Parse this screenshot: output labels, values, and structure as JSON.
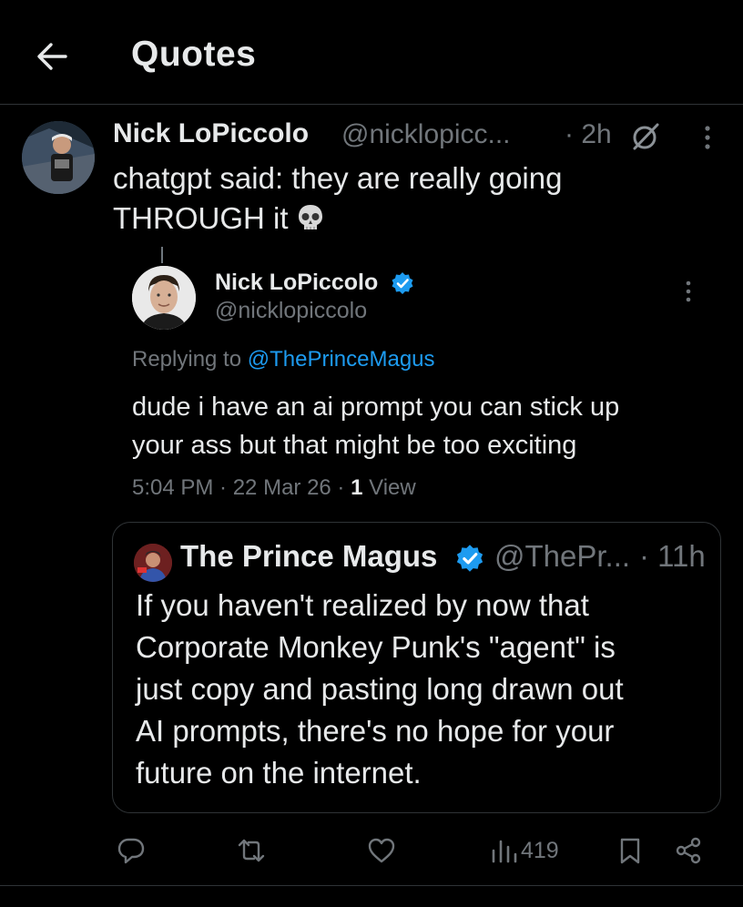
{
  "header": {
    "title": "Quotes"
  },
  "tweet": {
    "name": "Nick LoPiccolo",
    "handle": "@nicklopicc...",
    "time": "· 2h",
    "text_line1": "chatgpt said: they are really going",
    "text_line2": "THROUGH it"
  },
  "quoted_reply": {
    "name": "Nick LoPiccolo",
    "handle": "@nicklopiccolo",
    "replying_prefix": "Replying to ",
    "replying_to": "@ThePrinceMagus",
    "text_line1": "dude i have an ai prompt you can stick up",
    "text_line2": "your ass but that might be too exciting",
    "meta_time": "5:04 PM · 22 Mar 26 · ",
    "meta_views": "1",
    "meta_views_label": " View"
  },
  "embedded_quote": {
    "name": "The Prince Magus",
    "handle": "@ThePr...",
    "time": "· 11h",
    "lines": [
      "If you haven't realized by now that",
      "Corporate Monkey Punk's \"agent\" is",
      "just copy and pasting long drawn out",
      "AI prompts, there's no hope for your",
      "future on the internet."
    ]
  },
  "actions": {
    "views": "419"
  },
  "colors": {
    "background": "#000000",
    "text": "#e7e9ea",
    "muted": "#71767b",
    "accent": "#1d9bf0",
    "border": "#2f3336"
  },
  "icons": [
    "back-arrow-icon",
    "grok-icon",
    "more-icon",
    "verified-badge-icon",
    "reply-icon",
    "retweet-icon",
    "like-icon",
    "views-icon",
    "bookmark-icon",
    "share-icon",
    "skull-emoji-icon"
  ]
}
